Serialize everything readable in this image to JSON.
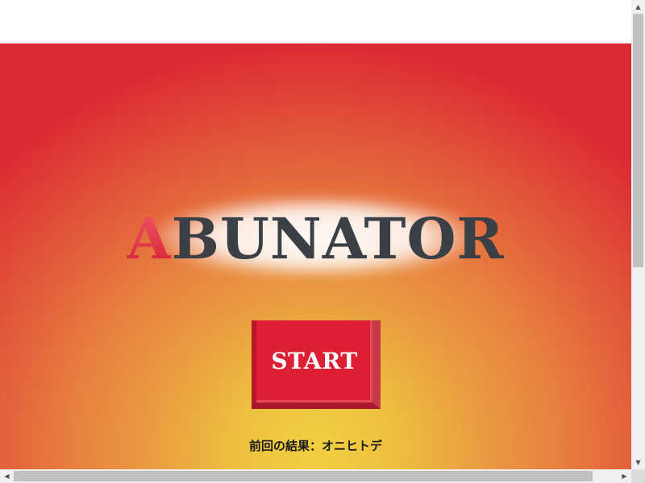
{
  "game": {
    "title_first_letter": "A",
    "title_rest": "BUNATOR",
    "start_label": "START",
    "last_result_label": "前回の結果：",
    "last_result_value": "オニヒトデ"
  },
  "colors": {
    "accent_red": "#dd1f34",
    "title_gray": "#3a4046",
    "bg_center": "#f0d040",
    "bg_edge": "#dc2a33"
  },
  "icons": {
    "scroll_up": "chevron-up-icon",
    "scroll_down": "chevron-down-icon",
    "scroll_left": "chevron-left-icon",
    "scroll_right": "chevron-right-icon"
  }
}
